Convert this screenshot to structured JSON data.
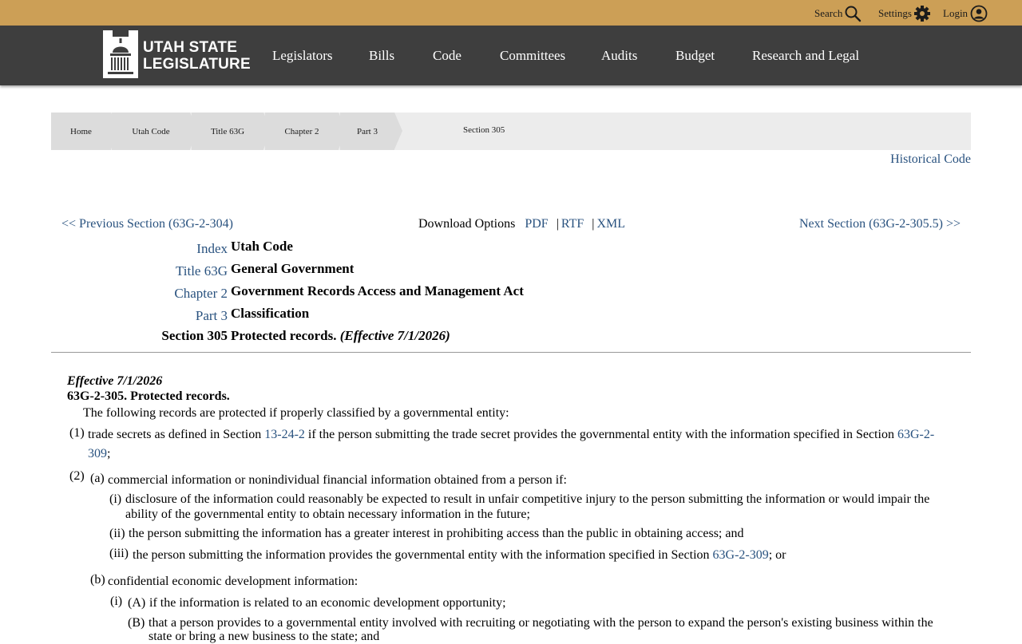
{
  "topbar": {
    "search_label": "Search",
    "settings_label": "Settings",
    "login_label": "Login"
  },
  "brand": {
    "line1": "UTAH STATE",
    "line2": "LEGISLATURE"
  },
  "nav": {
    "items": [
      "Legislators",
      "Bills",
      "Code",
      "Committees",
      "Audits",
      "Budget",
      "Research and Legal"
    ]
  },
  "breadcrumb": {
    "items": [
      "Home",
      "Utah Code",
      "Title 63G",
      "Chapter 2",
      "Part 3"
    ],
    "current": "Section 305"
  },
  "historical_link": "Historical Code",
  "pager": {
    "previous": "<< Previous Section (63G-2-304)",
    "next": "Next Section (63G-2-305.5) >>",
    "download_label": "Download Options",
    "formats": [
      "PDF",
      "RTF",
      "XML"
    ]
  },
  "hierarchy": [
    {
      "label": "Index",
      "value": "Utah Code"
    },
    {
      "label": "Title 63G",
      "value": "General Government"
    },
    {
      "label": "Chapter 2",
      "value": "Government Records Access and Management Act"
    },
    {
      "label": "Part 3",
      "value": "Classification"
    },
    {
      "label": "Section 305",
      "value": "Protected records.",
      "effective": "(Effective 7/1/2026)"
    }
  ],
  "section": {
    "effective": "Effective 7/1/2026",
    "heading": "63G-2-305.  Protected records.",
    "intro": "The following records are protected if properly classified by a governmental entity:",
    "p1": {
      "num": "(1)",
      "text_a": "trade secrets as defined in Section ",
      "link_a": "13-24-2",
      "text_b": " if the person submitting the trade secret provides the governmental entity with the information specified in Section ",
      "link_b1": "63G-2-",
      "link_b2": "309",
      "text_c": ";"
    },
    "p2": {
      "num": "(2)",
      "a_num": "(a)",
      "a_text": "commercial information or nonindividual financial information obtained from a person if:",
      "i_num": "(i)",
      "i_text1": "disclosure of the information could reasonably be expected to result in unfair competitive injury to the person submitting the information or would impair the",
      "i_text2": "ability of the governmental entity to obtain necessary information in the future;",
      "ii_num": "(ii)",
      "ii_text": "the person submitting the information has a greater interest in prohibiting access than the public in obtaining access; and",
      "iii_num": "(iii)",
      "iii_text": "the person submitting the information provides the governmental entity with the information specified in Section ",
      "iii_link": "63G-2-309",
      "iii_end": "; or",
      "b_num": "(b)",
      "b_text": "confidential economic development information:",
      "bi_num": "(i)",
      "A_num": "(A)",
      "A_text": "if the information is related to an economic development opportunity;",
      "B_num": "(B)",
      "B_text1": "that a person provides to a governmental entity involved with recruiting or negotiating with the person to expand the person's existing business within the",
      "B_text2": "state or bring a new business to the state; and"
    }
  }
}
